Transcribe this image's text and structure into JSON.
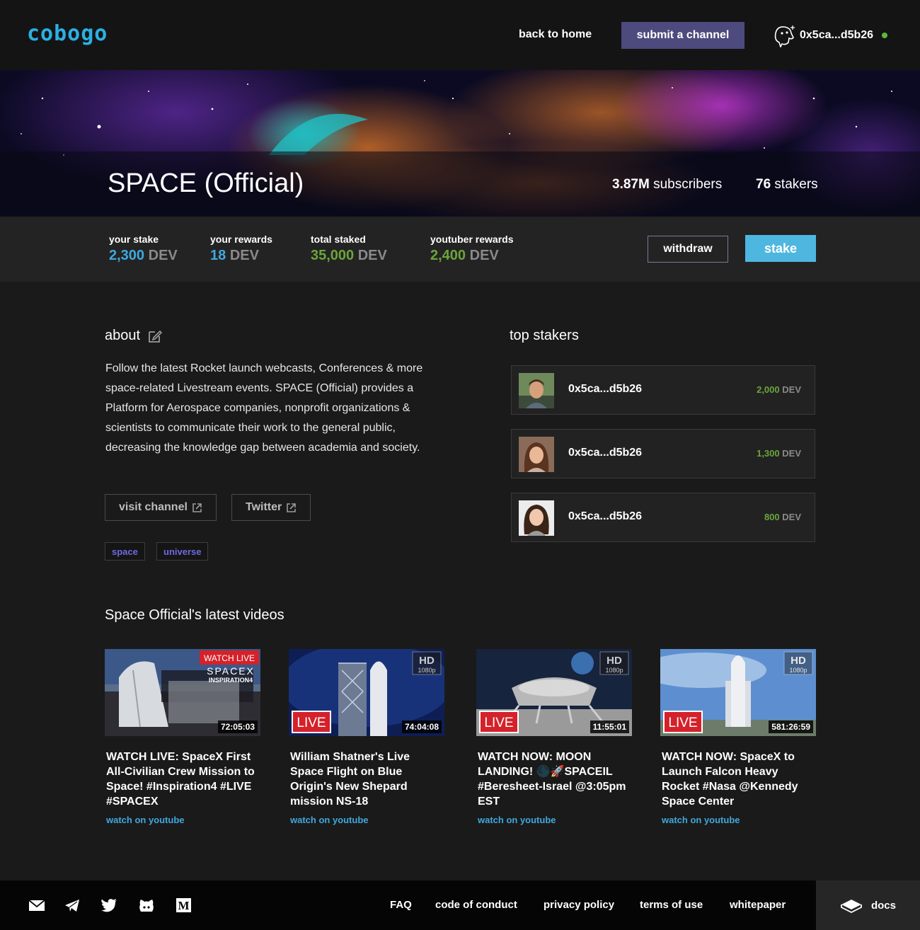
{
  "header": {
    "logo": "cobogo",
    "nav_home": "back to home",
    "submit_label": "submit a channel",
    "user_address": "0x5ca...d5b26",
    "user_icon": "dog-avatar-icon",
    "status_color": "#5cb83a"
  },
  "channel": {
    "title": "SPACE (Official)",
    "subscribers_count": "3.87M",
    "subscribers_label": "subscribers",
    "stakers_count": "76",
    "stakers_label": "stakers"
  },
  "stats": [
    {
      "label": "your stake",
      "value": "2,300",
      "unit": "DEV",
      "color": "#3fa9dd"
    },
    {
      "label": "your rewards",
      "value": "18",
      "unit": "DEV",
      "color": "#3fa9dd"
    },
    {
      "label": "total staked",
      "value": "35,000",
      "unit": "DEV",
      "color": "#6ba53a"
    },
    {
      "label": "youtuber rewards",
      "value": "2,400",
      "unit": "DEV",
      "color": "#6ba53a"
    }
  ],
  "actions": {
    "withdraw_label": "withdraw",
    "stake_label": "stake"
  },
  "about": {
    "heading": "about",
    "text": "Follow the latest Rocket launch webcasts, Conferences & more space-related Livestream events. SPACE (Official) provides a Platform for Aerospace companies, nonprofit organizations & scientists to communicate their work to the general public, decreasing the knowledge gap between academia and society.",
    "visit_channel_label": "visit channel",
    "twitter_label": "Twitter",
    "tags": [
      "space",
      "universe"
    ]
  },
  "top_stakers": {
    "heading": "top stakers",
    "items": [
      {
        "address": "0x5ca...d5b26",
        "amount": "2,000",
        "unit": "DEV"
      },
      {
        "address": "0x5ca...d5b26",
        "amount": "1,300",
        "unit": "DEV"
      },
      {
        "address": "0x5ca...d5b26",
        "amount": "800",
        "unit": "DEV"
      }
    ]
  },
  "videos": {
    "heading": "Space Official's latest videos",
    "watch_label": "watch on youtube",
    "items": [
      {
        "title": "WATCH LIVE: SpaceX First All-Civilian Crew Mission to Space! #Inspiration4 #LIVE #SPACEX",
        "duration": "72:05:03",
        "badge": "WATCH LIVE",
        "overlay": "SPACEX",
        "overlay_sub": "INSPIRATION4"
      },
      {
        "title": "William Shatner's Live Space Flight on Blue Origin's New Shepard mission NS-18",
        "duration": "74:04:08",
        "badge": "LIVE",
        "hd": "HD",
        "res": "1080p"
      },
      {
        "title": "WATCH NOW: MOON LANDING! 🌑🚀SPACEIL #Beresheet-Israel @3:05pm EST",
        "duration": "11:55:01",
        "badge": "LIVE",
        "hd": "HD",
        "res": "1080p"
      },
      {
        "title": "WATCH NOW: SpaceX to Launch Falcon Heavy Rocket #Nasa @Kennedy Space Center",
        "duration": "581:26:59",
        "badge": "LIVE",
        "hd": "HD",
        "res": "1080p"
      }
    ]
  },
  "footer": {
    "icons": [
      "email-icon",
      "telegram-icon",
      "twitter-icon",
      "github-icon",
      "medium-icon"
    ],
    "links": [
      "FAQ",
      "code of conduct",
      "privacy policy",
      "terms of use",
      "whitepaper"
    ],
    "docs_label": "docs"
  }
}
